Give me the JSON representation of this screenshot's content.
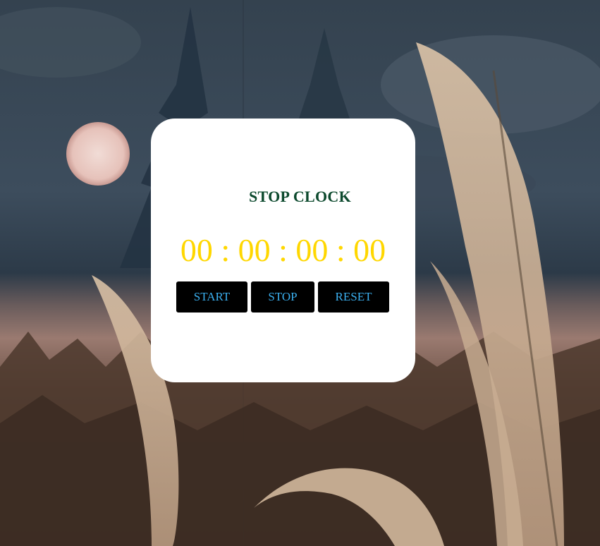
{
  "app": {
    "title": "STOP CLOCK"
  },
  "timer": {
    "hours": "00",
    "minutes": "00",
    "seconds": "00",
    "centiseconds": "00",
    "separator": ":"
  },
  "controls": {
    "start_label": "START",
    "stop_label": "STOP",
    "reset_label": "RESET"
  },
  "colors": {
    "title": "#0d4a2e",
    "timer_digits": "#ffd700",
    "button_bg": "#000000",
    "button_text": "#3bb0f0",
    "card_bg": "#ffffff"
  },
  "background": {
    "icon": "pampas-grass-moon-forest-photo"
  }
}
